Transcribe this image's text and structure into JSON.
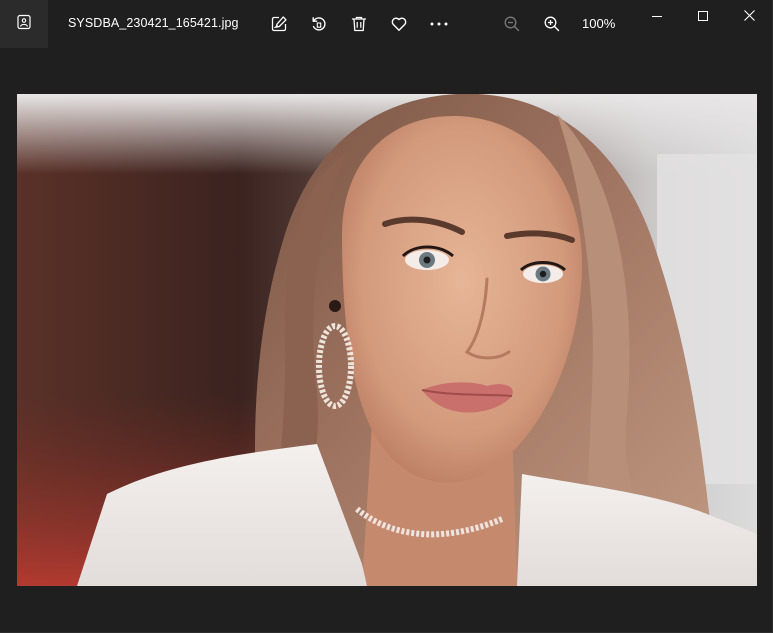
{
  "window": {
    "file_name": "SYSDBA_230421_165421.jpg",
    "zoom_level": "100%"
  },
  "toolbar": {
    "items": [
      {
        "name": "edit-image-icon"
      },
      {
        "name": "rotate-icon"
      },
      {
        "name": "delete-icon"
      },
      {
        "name": "favorite-heart-icon"
      },
      {
        "name": "more-options-icon"
      },
      {
        "name": "zoom-out-icon",
        "disabled": true
      },
      {
        "name": "zoom-in-icon"
      }
    ]
  },
  "window_controls": [
    "minimize-icon",
    "maximize-icon",
    "close-icon"
  ],
  "image": {
    "subject": "portrait photo"
  },
  "colors": {
    "window_bg": "#1f1f1f",
    "icon_box_bg": "#2b2b2b",
    "icon_color": "#ffffff",
    "disabled_icon_color": "#7a7a7a"
  }
}
